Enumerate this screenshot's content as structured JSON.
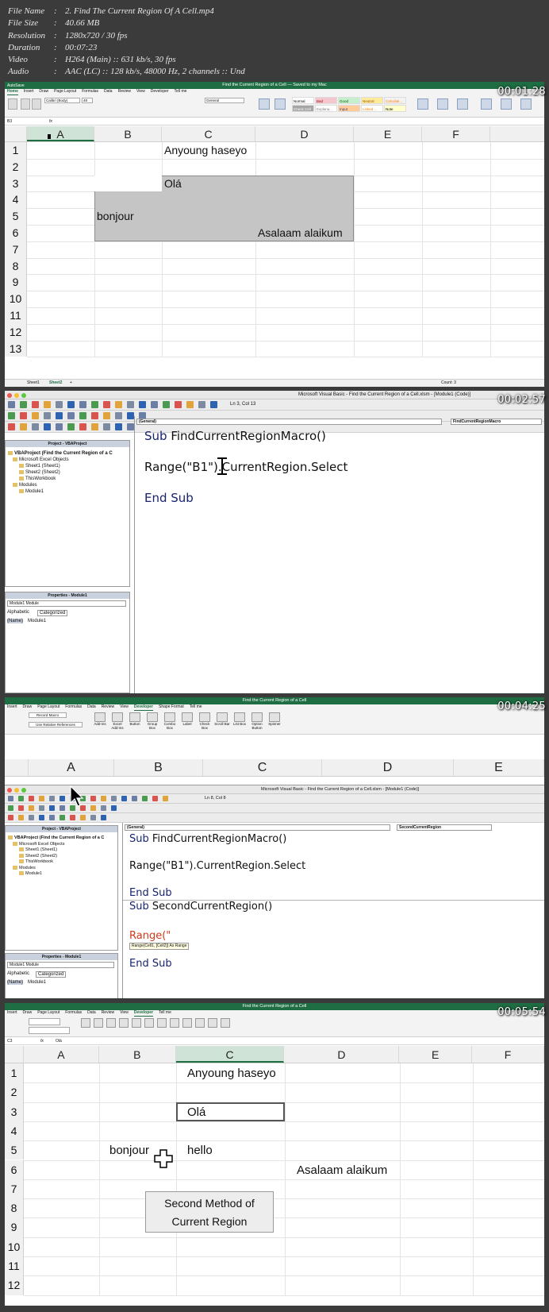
{
  "file_info": [
    {
      "key": "File Name",
      "value": "2. Find The Current Region Of A Cell.mp4"
    },
    {
      "key": "File Size",
      "value": "40.66 MB"
    },
    {
      "key": "Resolution",
      "value": "1280x720 / 30 fps"
    },
    {
      "key": "Duration",
      "value": "00:07:23"
    },
    {
      "key": "Video",
      "value": "H264 (Main) :: 631 kb/s, 30 fps"
    },
    {
      "key": "Audio",
      "value": "AAC (LC) :: 128 kb/s, 48000 Hz, 2 channels :: Und"
    }
  ],
  "frame1": {
    "timestamp": "00:01:28",
    "title": "Find the Current Region of a Cell — Saved to my Mac",
    "autosave": "AutoSave",
    "tabs": [
      "Home",
      "Insert",
      "Draw",
      "Page Layout",
      "Formulas",
      "Data",
      "Review",
      "View",
      "Developer",
      "Tell me"
    ],
    "font_name": "Calibri (Body)",
    "font_size": "48",
    "number_format": "General",
    "styles": [
      "Normal",
      "Bad",
      "Good",
      "Neutral",
      "Calculati...",
      "Check Cell",
      "Explana...",
      "Input",
      "Linked ...",
      "Note"
    ],
    "name_box": "B3",
    "fx": "fx",
    "columns": [
      "A",
      "B",
      "C",
      "D",
      "E",
      "F"
    ],
    "rows": [
      "1",
      "2",
      "3",
      "4",
      "5",
      "6",
      "7",
      "8",
      "9",
      "10",
      "11",
      "12",
      "13"
    ],
    "cells": {
      "c1": "Anyoung haseyo",
      "c3": "Olá",
      "b5": "bonjour",
      "d6": "Asalaam alaikum"
    },
    "sheets": [
      "Sheet1",
      "Sheet2",
      "+"
    ],
    "count": "Count: 3"
  },
  "frame2": {
    "timestamp": "00:02:57",
    "title": "Microsoft Visual Basic - Find the Current Region of a Cell.xlsm - [Module1 (Code)]",
    "position": "Ln 3, Col 13",
    "project_title": "Project - VBAProject",
    "tree": [
      "VBAProject (Find the Current Region of a C",
      "Microsoft Excel Objects",
      "Sheet1 (Sheet1)",
      "Sheet2 (Sheet2)",
      "ThisWorkbook",
      "Modules",
      "Module1"
    ],
    "properties_title": "Properties - Module1",
    "props_combo": "Module1 Module",
    "props_tabs": [
      "Alphabetic",
      "Categorized"
    ],
    "props_row": {
      "name": "(Name)",
      "value": "Module1"
    },
    "combo_general": "(General)",
    "combo_proc": "FindCurrentRegionMacro",
    "code": {
      "l1_kw": "Sub",
      "l1": " FindCurrentRegionMacro()",
      "l2": "Range(\"B1\").CurrentRegion.Select",
      "l3": "End Sub"
    }
  },
  "frame3": {
    "timestamp": "00:04:25",
    "title": "Find the Current Region of a Cell",
    "tabs": [
      "Insert",
      "Draw",
      "Page Layout",
      "Formulas",
      "Data",
      "Review",
      "View",
      "Developer",
      "Shape Format",
      "Tell me"
    ],
    "ribbon": [
      "Record Macro",
      "Use Relative References",
      "Add-ins",
      "Excel Add-ins",
      "Button",
      "Group Box",
      "Combo Box",
      "Label",
      "Check Box",
      "Scroll Bar",
      "List Box",
      "Option Button",
      "Spinner"
    ],
    "columns": [
      "A",
      "B",
      "C",
      "D",
      "E"
    ],
    "vbe_title": "Microsoft Visual Basic - Find the Current Region of a Cell.xlsm - [Module1 (Code)]",
    "position": "Ln 8, Col 8",
    "project_title": "Project - VBAProject",
    "tree": [
      "VBAProject (Find the Current Region of a C",
      "Microsoft Excel Objects",
      "Sheet1 (Sheet1)",
      "Sheet2 (Sheet2)",
      "ThisWorkbook",
      "Modules",
      "Module1"
    ],
    "properties_title": "Properties - Module1",
    "props_combo": "Module1 Module",
    "props_tabs": [
      "Alphabetic",
      "Categorized"
    ],
    "props_row": {
      "name": "(Name)",
      "value": "Module1"
    },
    "combo_general": "(General)",
    "combo_proc": "SecondCurrentRegion",
    "code": {
      "l1_kw": "Sub",
      "l1": " FindCurrentRegionMacro()",
      "l2": "Range(\"B1\").CurrentRegion.Select",
      "l3": "End Sub",
      "l4_kw": "Sub",
      "l4": " SecondCurrentRegion()",
      "l5": "Range(\"",
      "tooltip": "Range(Cell1, [Cell2]) As Range",
      "l6": "End Sub"
    }
  },
  "frame4": {
    "timestamp": "00:05:54",
    "title": "Find the Current Region of a Cell",
    "tabs": [
      "Insert",
      "Draw",
      "Page Layout",
      "Formulas",
      "Data",
      "Review",
      "View",
      "Developer",
      "Tell me"
    ],
    "name_box": "C3",
    "fx": "fx",
    "formula": "Olá",
    "columns": [
      "A",
      "B",
      "C",
      "D",
      "E",
      "F"
    ],
    "rows": [
      "1",
      "2",
      "3",
      "4",
      "5",
      "6",
      "7",
      "8",
      "9",
      "10",
      "11",
      "12"
    ],
    "cells": {
      "c1": "Anyoung haseyo",
      "c3": "Olá",
      "b5": "bonjour",
      "c5": "hello",
      "d6": "Asalaam alaikum"
    },
    "button": "Second Method of Current Region"
  }
}
